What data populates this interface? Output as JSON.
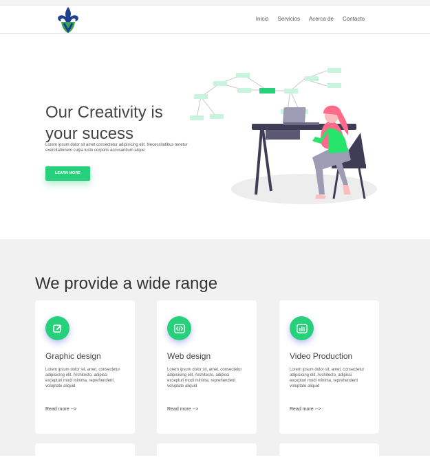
{
  "nav": {
    "logo_icon": "fleur-de-lis-logo",
    "links": [
      "Inicio",
      "Servicios",
      "Acerca de",
      "Contacto"
    ]
  },
  "hero": {
    "title": "Our Creativity is your sucess",
    "text": "Lorem ipsum dolor sit amet consectetur adipisicing elit. Necessitatibus tenetur exercitationem culpa iusto corporis accusantium atque",
    "button_label": "LEARN MORE"
  },
  "services": {
    "title": "We provide a wide range",
    "cards": [
      {
        "icon": "edit-icon",
        "title": "Graphic design",
        "text": "Lorem ipsum dolor sit, amet, consectetur adipisicing elit. Architecto, adipisci excepturi modi minima, reprehenderit voluptate aliquid",
        "link": "Read more -->"
      },
      {
        "icon": "code-icon",
        "title": "Web design",
        "text": "Lorem ipsum dolor sit, amet, consectetur adipisicing elit. Architecto, adipisci excepturi modi minima, reprehenderit voluptate aliquid",
        "link": "Read more -->"
      },
      {
        "icon": "bar-chart-icon",
        "title": "Video Production",
        "text": "Lorem ipsum dolor sit, amet, consectetur adipisicing elit. Architecto, adipisci excepturi modi minima, reprehenderit voluptate aliquid",
        "link": "Read more -->"
      }
    ]
  },
  "colors": {
    "accent": "#27d07a",
    "logo_blue": "#1c3f8f",
    "logo_green": "#3aa655"
  }
}
